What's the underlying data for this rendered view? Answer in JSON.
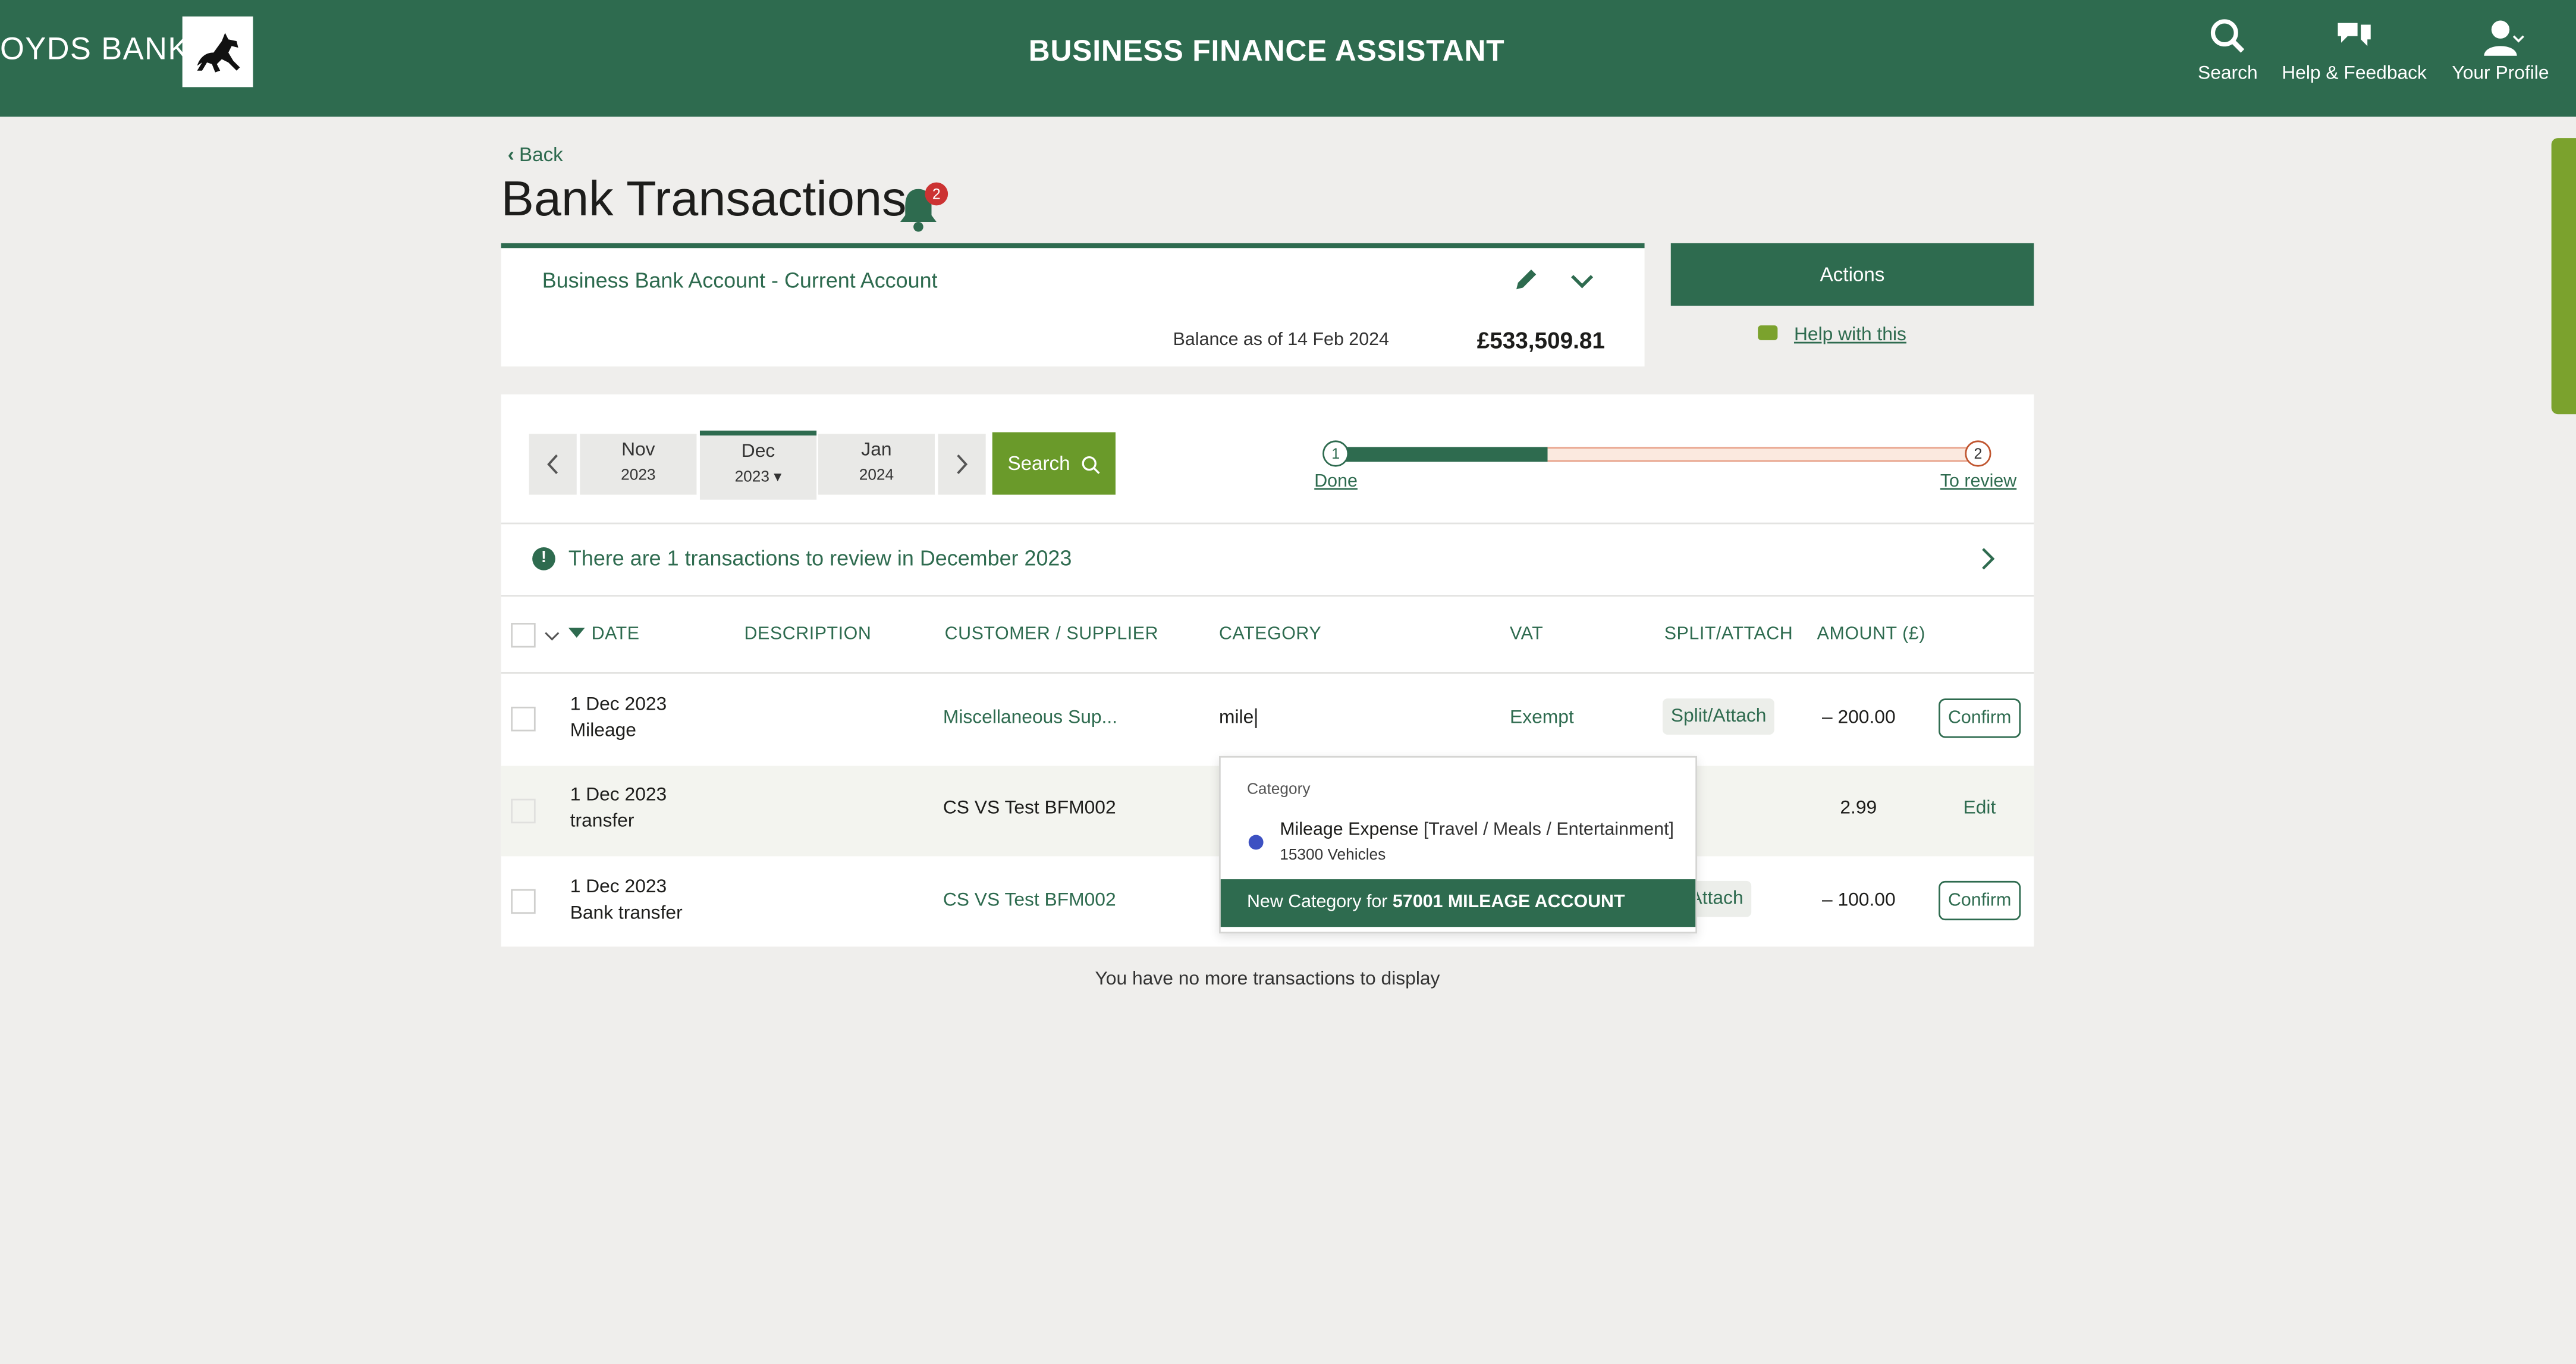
{
  "header": {
    "brand": "OYDS BANK",
    "app_title": "BUSINESS FINANCE ASSISTANT",
    "nav": [
      {
        "label": "Search",
        "icon": "search-icon"
      },
      {
        "label": "Help & Feedback",
        "icon": "chat-bubbles-icon"
      },
      {
        "label": "Your Profile",
        "icon": "user-icon"
      }
    ]
  },
  "page": {
    "back_label": "Back",
    "title": "Bank Transactions",
    "notification_count": "2"
  },
  "account": {
    "name": "Business Bank Account - Current Account",
    "balance_label": "Balance as of 14 Feb 2024",
    "balance_value": "£533,509.81"
  },
  "side": {
    "actions_label": "Actions",
    "help_label": "Help with this"
  },
  "period": {
    "months": [
      {
        "month": "Nov",
        "year": "2023"
      },
      {
        "month": "Dec",
        "year": "2023 ▾"
      },
      {
        "month": "Jan",
        "year": "2024"
      }
    ],
    "search_label": "Search"
  },
  "progress": {
    "done_fraction": 0.32,
    "step1_number": "1",
    "step1_label": "Done",
    "step2_number": "2",
    "step2_label": "To review"
  },
  "review_banner": {
    "text": "There are 1 transactions to review in December 2023"
  },
  "table": {
    "headers": [
      "DATE",
      "DESCRIPTION",
      "CUSTOMER / SUPPLIER",
      "CATEGORY",
      "VAT",
      "SPLIT/ATTACH",
      "AMOUNT (£)"
    ],
    "rows": [
      {
        "date": "1 Dec 2023",
        "desc": "Mileage",
        "supplier": "Miscellaneous Sup...",
        "category": "mile",
        "vat": "Exempt",
        "split": "Split/Attach",
        "amount": "– 200.00",
        "action": "Confirm"
      },
      {
        "date": "1 Dec 2023",
        "desc": "transfer",
        "supplier": "CS VS Test BFM002",
        "category": "",
        "vat": "",
        "split": "",
        "amount": "2.99",
        "action": "Edit"
      },
      {
        "date": "1 Dec 2023",
        "desc": "Bank transfer",
        "supplier": "CS VS Test BFM002",
        "category": "",
        "vat": "",
        "split": "lit/Attach",
        "amount": "– 100.00",
        "action": "Confirm"
      }
    ]
  },
  "dropdown": {
    "heading": "Category",
    "option_name": "Mileage Expense",
    "option_path": "[Travel / Meals / Entertainment]",
    "option_sub": "15300 Vehicles",
    "new_prefix": "New Category for",
    "new_value": "57001 MILEAGE ACCOUNT"
  },
  "footer_note": "You have no more transactions to display",
  "colors": {
    "brand_green": "#2e6b4f",
    "accent_green": "#6a9a2a",
    "alert_red": "#cc3333",
    "option_dot": "#3d51c2"
  }
}
